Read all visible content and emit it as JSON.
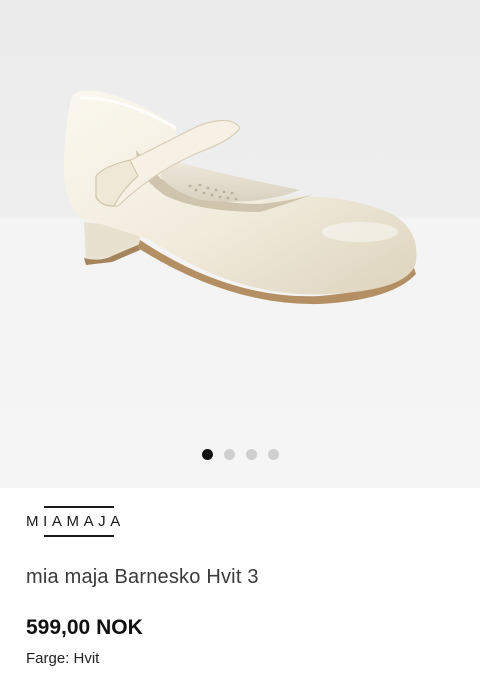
{
  "product_image": {
    "alt_icon": "white-mary-jane-shoe",
    "background_top": "#ececec",
    "background_bottom": "#f5f5f5",
    "carousel": {
      "total": 4,
      "active_index": 0
    }
  },
  "brand": {
    "name": "MIAMAJA"
  },
  "product": {
    "title": "mia maja Barnesko Hvit 3",
    "price": "599,00 NOK",
    "color_label": "Farge: Hvit"
  },
  "colors": {
    "text": "#1a1a1a",
    "dot_active": "#111111",
    "dot_inactive": "#cfcfcf"
  }
}
